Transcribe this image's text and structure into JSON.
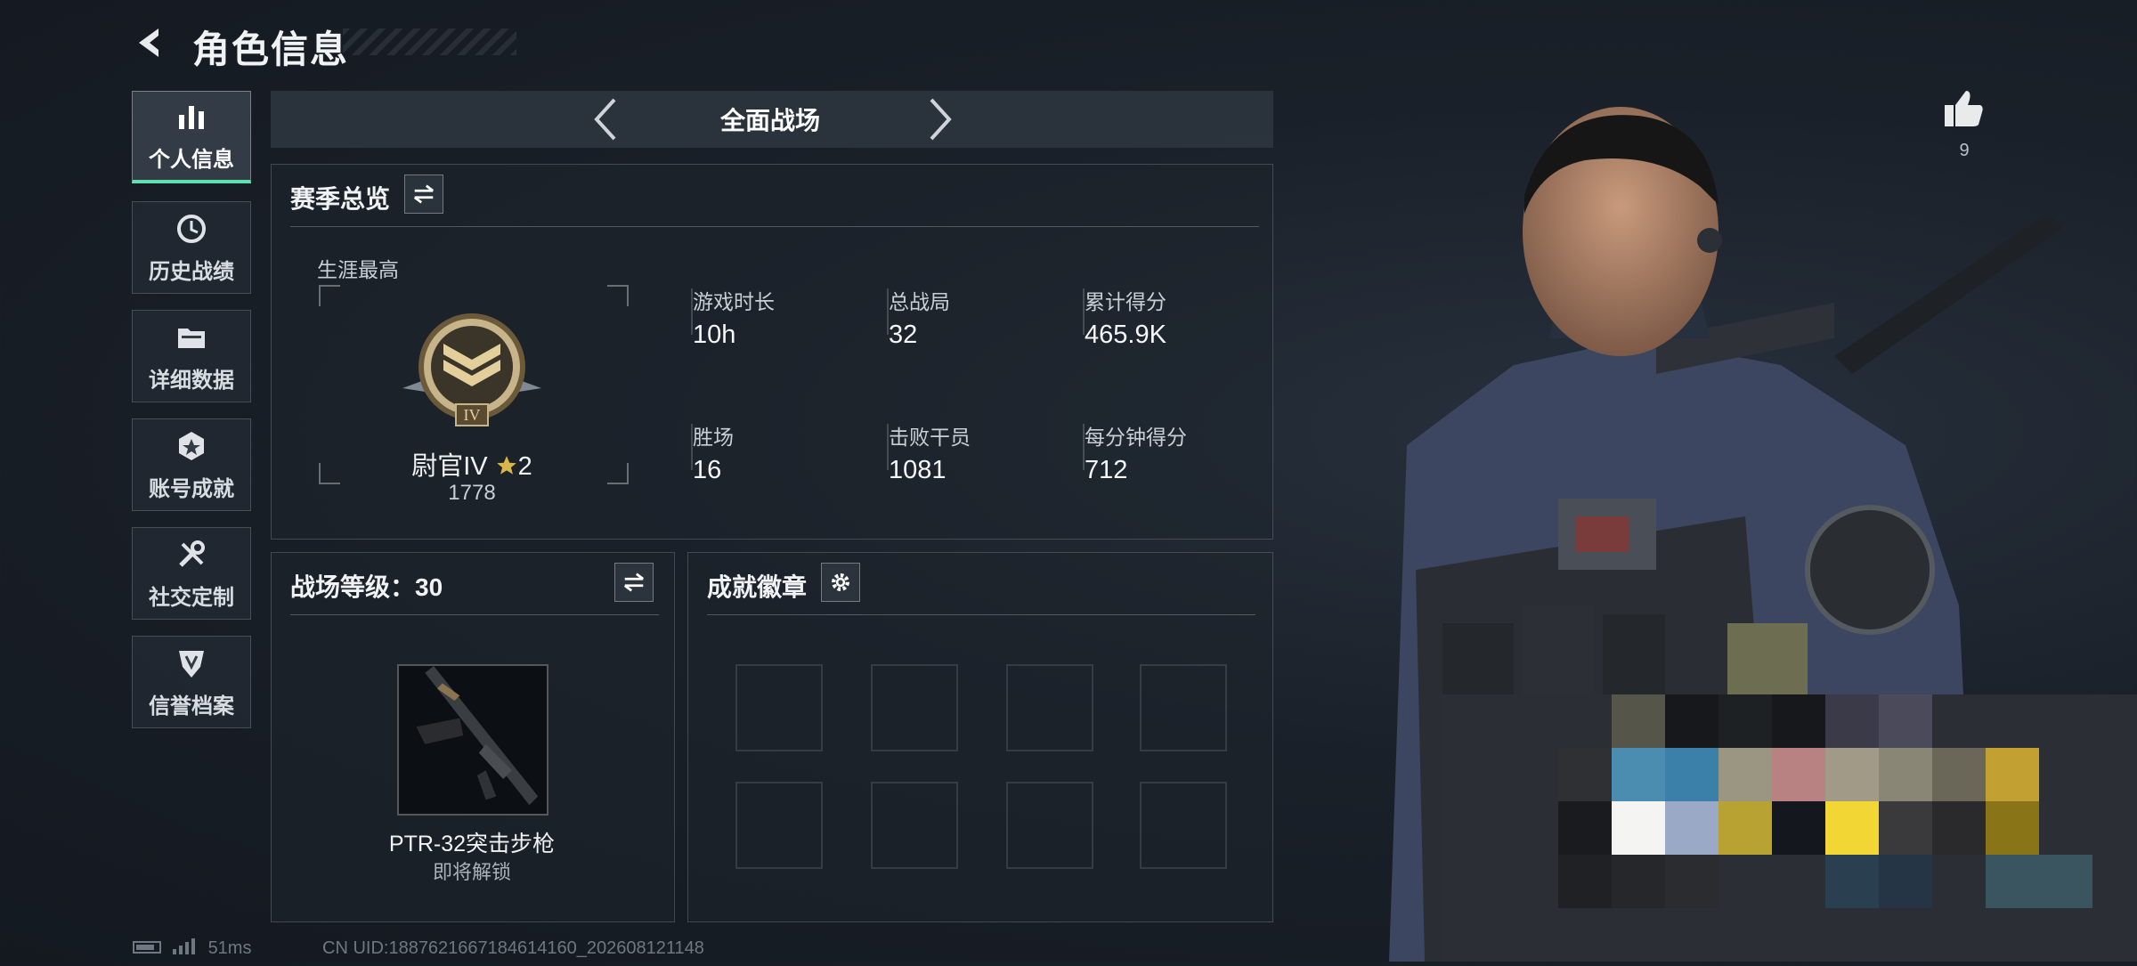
{
  "header": {
    "title": "角色信息"
  },
  "sidebar": {
    "items": [
      {
        "label": "个人信息",
        "active": true,
        "icon": "bar-chart-icon"
      },
      {
        "label": "历史战绩",
        "active": false,
        "icon": "history-clock-icon"
      },
      {
        "label": "详细数据",
        "active": false,
        "icon": "folder-icon"
      },
      {
        "label": "账号成就",
        "active": false,
        "icon": "achievement-star-icon"
      },
      {
        "label": "社交定制",
        "active": false,
        "icon": "wrench-tools-icon"
      },
      {
        "label": "信誉档案",
        "active": false,
        "icon": "shield-badge-icon"
      }
    ]
  },
  "mode": {
    "title": "全面战场"
  },
  "season": {
    "title": "赛季总览",
    "career_label": "生涯最高",
    "rank_name": "尉官IV",
    "rank_stars": "2",
    "rank_points": "1778",
    "rank_emblem_numeral": "IV",
    "stats": [
      {
        "label": "游戏时长",
        "value": "10h"
      },
      {
        "label": "总战局",
        "value": "32"
      },
      {
        "label": "累计得分",
        "value": "465.9K"
      },
      {
        "label": "胜场",
        "value": "16"
      },
      {
        "label": "击败干员",
        "value": "1081"
      },
      {
        "label": "每分钟得分",
        "value": "712"
      }
    ]
  },
  "battlefield_level": {
    "title": "战场等级：30",
    "weapon_name": "PTR-32突击步枪",
    "weapon_status": "即将解锁"
  },
  "badges": {
    "title": "成就徽章",
    "slots": 8
  },
  "likes": {
    "count": "9"
  },
  "footer": {
    "ping": "51ms",
    "uid": "CN UID:1887621667184614160_202608121148"
  },
  "colors": {
    "accent": "#5fe0b0",
    "star": "#d9b54a",
    "background": "#1a2029"
  }
}
